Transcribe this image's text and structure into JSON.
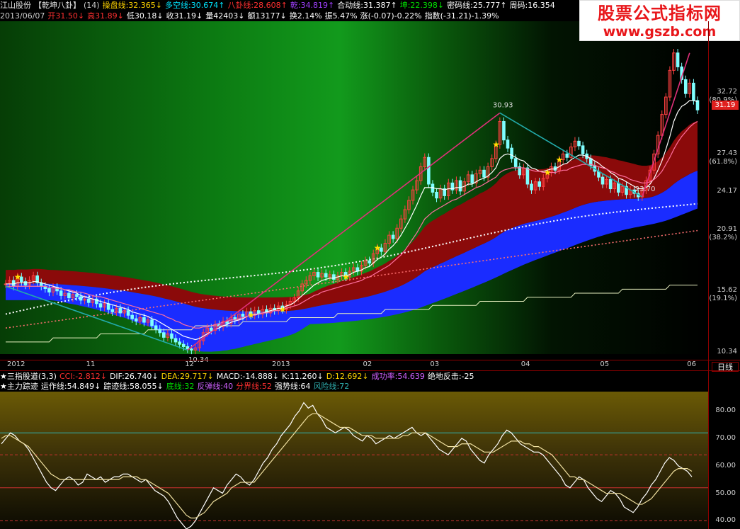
{
  "header": {
    "row1": [
      {
        "text": "江山股份",
        "color": "#e6e6e6"
      },
      {
        "text": "【乾坤八卦】",
        "color": "#e6e6e6"
      },
      {
        "text": "(14)",
        "color": "#cccccc"
      },
      {
        "text": "操盘线:32.365↓",
        "color": "#ffd400"
      },
      {
        "text": "多空线:30.674↑",
        "color": "#00e5ff"
      },
      {
        "text": "八卦线:28.608↑",
        "color": "#ff3030"
      },
      {
        "text": "乾:34.819↑",
        "color": "#a040ff"
      },
      {
        "text": "合动线:31.387↑",
        "color": "#ffffff"
      },
      {
        "text": "坤:22.398↓",
        "color": "#00e000"
      },
      {
        "text": "密码线:25.777↑",
        "color": "#ffffff"
      },
      {
        "text": "周码:16.354",
        "color": "#ffffff"
      }
    ],
    "row2": [
      {
        "text": "2013/06/07",
        "color": "#cccccc"
      },
      {
        "text": "开31.50↓",
        "color": "#ff3030"
      },
      {
        "text": "高31.89↓",
        "color": "#ff3030"
      },
      {
        "text": "低30.18↓",
        "color": "#ffffff"
      },
      {
        "text": "收31.19↓",
        "color": "#ffffff"
      },
      {
        "text": "量42403↓",
        "color": "#ffffff"
      },
      {
        "text": "额13177↓",
        "color": "#ffffff"
      },
      {
        "text": "换2.14%",
        "color": "#ffffff"
      },
      {
        "text": "振5.47%",
        "color": "#ffffff"
      },
      {
        "text": "涨(-0.07)-0.22%",
        "color": "#ffffff"
      },
      {
        "text": "指数(-31.21)-1.39%",
        "color": "#ffffff"
      }
    ]
  },
  "logo": {
    "line1": "股票公式指标网",
    "line2": "www.gszb.com"
  },
  "chart_data": [
    {
      "type": "line",
      "title": "",
      "ylim": [
        10.34,
        37.0
      ],
      "y_ticks": [
        {
          "v": 32.72,
          "pct": "(80.9%)"
        },
        {
          "v": 27.43,
          "pct": "(61.8%)"
        },
        {
          "v": 24.17,
          "pct": ""
        },
        {
          "v": 20.91,
          "pct": "(38.2%)"
        },
        {
          "v": 15.62,
          "pct": "(19.1%)"
        },
        {
          "v": 10.34,
          "pct": ""
        }
      ],
      "x_ticks": [
        {
          "label": "2012",
          "i": 0
        },
        {
          "label": "11",
          "i": 20
        },
        {
          "label": "12",
          "i": 45
        },
        {
          "label": "2013",
          "i": 67
        },
        {
          "label": "02",
          "i": 90
        },
        {
          "label": "03",
          "i": 107
        },
        {
          "label": "04",
          "i": 130
        },
        {
          "label": "05",
          "i": 150
        },
        {
          "label": "06",
          "i": 172
        }
      ],
      "current_price": "31.19",
      "annotations": [
        {
          "text": "30.93",
          "i": 125,
          "v": 30.93
        },
        {
          "text": "23.70",
          "i": 161,
          "v": 23.7
        },
        {
          "text": "10.34",
          "i": 48,
          "v": 10.34
        }
      ],
      "close": [
        16.2,
        16.5,
        16.0,
        16.8,
        16.4,
        16.1,
        16.5,
        16.9,
        16.3,
        16.0,
        15.8,
        15.5,
        15.9,
        15.6,
        15.2,
        15.4,
        15.0,
        15.3,
        15.1,
        14.8,
        14.9,
        14.6,
        14.9,
        14.5,
        14.2,
        14.5,
        14.0,
        13.8,
        14.1,
        13.7,
        13.9,
        13.5,
        13.2,
        13.0,
        13.3,
        12.9,
        13.1,
        12.6,
        12.3,
        12.0,
        11.6,
        11.9,
        11.5,
        11.2,
        11.0,
        10.8,
        10.6,
        10.5,
        10.7,
        11.3,
        12.0,
        12.4,
        12.2,
        12.7,
        12.5,
        13.0,
        12.8,
        13.3,
        13.1,
        13.6,
        13.4,
        13.8,
        13.5,
        13.9,
        13.6,
        14.0,
        13.7,
        14.1,
        13.9,
        14.3,
        14.0,
        14.4,
        14.7,
        15.0,
        15.6,
        16.2,
        16.5,
        16.9,
        17.2,
        16.8,
        17.1,
        16.8,
        17.0,
        16.6,
        16.9,
        17.2,
        16.8,
        17.3,
        17.6,
        17.3,
        17.8,
        18.2,
        18.0,
        18.8,
        19.3,
        19.0,
        19.7,
        20.4,
        20.1,
        21.0,
        21.8,
        22.6,
        23.4,
        24.3,
        25.1,
        26.3,
        27.1,
        24.8,
        24.1,
        23.6,
        24.4,
        23.8,
        24.9,
        24.3,
        25.1,
        24.2,
        25.0,
        25.6,
        24.9,
        25.7,
        26.0,
        25.4,
        26.3,
        27.0,
        28.2,
        30.2,
        28.6,
        27.9,
        27.0,
        26.3,
        25.6,
        26.2,
        24.8,
        24.3,
        25.0,
        24.6,
        25.3,
        25.8,
        26.3,
        26.0,
        26.9,
        27.4,
        27.1,
        28.0,
        28.5,
        28.1,
        27.4,
        27.0,
        26.4,
        25.9,
        25.4,
        24.8,
        25.2,
        24.4,
        24.9,
        24.1,
        24.6,
        23.9,
        24.3,
        24.0,
        23.7,
        24.3,
        25.1,
        26.0,
        27.4,
        29.0,
        30.8,
        32.3,
        34.6,
        36.1,
        34.9,
        33.8,
        32.6,
        33.5,
        32.0,
        31.19
      ],
      "series": [
        {
          "name": "",
          "color": "#ffffff",
          "values": [
            16.2,
            16.2,
            16.2,
            16.3,
            16.3,
            16.3,
            16.3,
            16.4,
            16.4,
            16.3,
            16.2,
            16.1,
            16.0,
            15.9,
            15.8,
            15.7,
            15.6,
            15.5,
            15.4,
            15.2,
            15.1,
            15.0,
            14.9,
            14.8,
            14.7,
            14.6,
            14.5,
            14.4,
            14.3,
            14.2,
            14.1,
            14.0,
            13.8,
            13.7,
            13.6,
            13.5,
            13.4,
            13.2,
            13.1,
            12.9,
            12.7,
            12.5,
            12.3,
            12.1,
            11.9,
            11.7,
            11.6,
            11.5,
            11.4,
            11.5,
            11.7,
            11.9,
            12.1,
            12.3,
            12.4,
            12.6,
            12.7,
            12.9,
            13.0,
            13.1,
            13.2,
            13.4,
            13.5,
            13.6,
            13.6,
            13.7,
            13.8,
            13.9,
            14.0,
            14.1,
            14.1,
            14.3,
            14.4,
            14.6,
            14.9,
            15.2,
            15.5,
            15.8,
            16.1,
            16.3,
            16.5,
            16.6,
            16.7,
            16.7,
            16.8,
            16.9,
            16.9,
            17.0,
            17.2,
            17.3,
            17.4,
            17.6,
            17.7,
            18.0,
            18.3,
            18.5,
            18.8,
            19.2,
            19.5,
            19.9,
            20.4,
            21.0,
            21.6,
            22.3,
            23.0,
            23.8,
            24.5,
            24.5,
            24.5,
            24.4,
            24.4,
            24.3,
            24.4,
            24.4,
            24.5,
            24.5,
            24.6,
            24.8,
            24.8,
            25.0,
            25.2,
            25.3,
            25.5,
            25.8,
            26.2,
            27.0,
            27.3,
            27.4,
            27.3,
            27.1,
            26.9,
            26.8,
            26.5,
            26.2,
            26.1,
            25.9,
            25.9,
            26.0,
            26.1,
            26.1,
            26.3,
            26.5,
            26.6,
            26.9,
            27.1,
            27.3,
            27.3,
            27.2,
            27.0,
            26.8,
            26.6,
            26.3,
            26.1,
            25.8,
            25.6,
            25.3,
            25.2,
            25.0,
            24.8,
            24.6,
            24.4,
            24.4,
            24.5,
            24.8,
            25.3,
            26.0,
            26.8,
            27.8,
            28.9,
            30.2,
            31.0,
            31.5,
            31.7,
            32.0,
            32.0,
            31.9
          ]
        },
        {
          "name": "",
          "color": "#ff6fa0",
          "values": [
            16.0,
            16.0,
            16.0,
            16.0,
            16.0,
            16.0,
            16.0,
            16.0,
            16.0,
            16.0,
            16.0,
            15.9,
            15.9,
            15.8,
            15.8,
            15.7,
            15.7,
            15.6,
            15.5,
            15.5,
            15.4,
            15.3,
            15.2,
            15.1,
            15.1,
            15.0,
            14.9,
            14.8,
            14.7,
            14.6,
            14.5,
            14.4,
            14.3,
            14.2,
            14.1,
            14.0,
            13.9,
            13.8,
            13.7,
            13.6,
            13.5,
            13.3,
            13.2,
            13.0,
            12.9,
            12.7,
            12.6,
            12.5,
            12.4,
            12.4,
            12.5,
            12.5,
            12.6,
            12.7,
            12.8,
            12.9,
            13.0,
            13.1,
            13.1,
            13.2,
            13.3,
            13.4,
            13.5,
            13.5,
            13.6,
            13.7,
            13.7,
            13.8,
            13.9,
            13.9,
            14.0,
            14.1,
            14.2,
            14.3,
            14.4,
            14.6,
            14.8,
            15.0,
            15.2,
            15.3,
            15.5,
            15.6,
            15.7,
            15.8,
            15.9,
            16.0,
            16.1,
            16.2,
            16.3,
            16.4,
            16.5,
            16.7,
            16.8,
            17.0,
            17.2,
            17.4,
            17.6,
            17.8,
            18.1,
            18.4,
            18.7,
            19.1,
            19.6,
            20.1,
            20.6,
            21.2,
            21.8,
            22.1,
            22.4,
            22.6,
            22.8,
            23.0,
            23.2,
            23.4,
            23.5,
            23.7,
            23.9,
            24.1,
            24.3,
            24.5,
            24.6,
            24.8,
            25.0,
            25.2,
            25.4,
            25.8,
            26.0,
            26.1,
            26.2,
            26.2,
            26.2,
            26.2,
            26.1,
            26.0,
            25.9,
            25.9,
            25.8,
            25.8,
            25.8,
            25.8,
            25.9,
            26.0,
            26.0,
            26.2,
            26.3,
            26.4,
            26.5,
            26.5,
            26.5,
            26.4,
            26.3,
            26.2,
            26.1,
            25.9,
            25.8,
            25.6,
            25.5,
            25.4,
            25.2,
            25.1,
            25.0,
            24.9,
            24.9,
            25.0,
            25.2,
            25.5,
            25.9,
            26.5,
            27.1,
            27.8,
            28.4,
            28.9,
            29.3,
            29.7,
            30.0,
            30.2
          ]
        }
      ]
    },
    {
      "type": "line",
      "ylim": [
        37,
        87
      ],
      "y_ticks": [
        80.0,
        70.0,
        60.0,
        50.0,
        40.0
      ],
      "ref_lines": [
        {
          "v": 72,
          "color": "#2fb0b0"
        },
        {
          "v": 64,
          "color": "#cc3030",
          "dash": true
        },
        {
          "v": 52,
          "color": "#cc3030"
        },
        {
          "v": 40,
          "color": "#cc3030",
          "dash": true
        }
      ],
      "series": [
        {
          "name": "运作线",
          "color": "#ffffff",
          "values": [
            68,
            70,
            72,
            71,
            69,
            68,
            66,
            63,
            60,
            57,
            54,
            52,
            51,
            53,
            55,
            56,
            55,
            53,
            54,
            57,
            56,
            55,
            56,
            54,
            55,
            56,
            56,
            57,
            57,
            56,
            55,
            54,
            55,
            53,
            51,
            50,
            49,
            47,
            44,
            41,
            39,
            37,
            38,
            40,
            43,
            46,
            49,
            52,
            51,
            50,
            53,
            55,
            57,
            56,
            54,
            53,
            55,
            58,
            61,
            63,
            66,
            68,
            71,
            73,
            75,
            78,
            80,
            83,
            81,
            82,
            79,
            77,
            74,
            73,
            72,
            73,
            74,
            73,
            71,
            70,
            69,
            71,
            70,
            68,
            69,
            70,
            71,
            70,
            71,
            72,
            73,
            74,
            72,
            71,
            72,
            70,
            68,
            66,
            65,
            64,
            66,
            68,
            70,
            69,
            66,
            64,
            62,
            61,
            64,
            66,
            68,
            71,
            73,
            72,
            70,
            68,
            67,
            66,
            65,
            65,
            64,
            62,
            60,
            58,
            56,
            53,
            52,
            54,
            56,
            55,
            52,
            50,
            48,
            47,
            49,
            51,
            50,
            48,
            45,
            44,
            43,
            45,
            48,
            50,
            53,
            55,
            58,
            61,
            63,
            62,
            60,
            59,
            58,
            56
          ]
        },
        {
          "name": "踪迹线",
          "color": "#f0e0a0",
          "values": [
            70,
            71,
            71,
            70,
            69,
            68,
            67,
            65,
            63,
            61,
            59,
            57,
            56,
            55,
            55,
            55,
            55,
            55,
            55,
            55,
            55,
            55,
            55,
            55,
            55,
            55,
            55,
            56,
            56,
            56,
            56,
            55,
            55,
            54,
            53,
            52,
            51,
            50,
            48,
            46,
            44,
            42,
            41,
            41,
            42,
            43,
            45,
            47,
            48,
            49,
            50,
            52,
            53,
            54,
            54,
            54,
            54,
            56,
            58,
            60,
            62,
            64,
            66,
            68,
            70,
            72,
            74,
            76,
            78,
            79,
            79,
            78,
            77,
            76,
            75,
            74,
            74,
            74,
            73,
            72,
            71,
            71,
            71,
            70,
            70,
            70,
            70,
            70,
            70,
            71,
            71,
            72,
            72,
            72,
            72,
            71,
            70,
            69,
            68,
            67,
            67,
            67,
            68,
            68,
            68,
            67,
            66,
            65,
            65,
            65,
            66,
            67,
            68,
            69,
            69,
            69,
            68,
            68,
            67,
            67,
            66,
            65,
            64,
            62,
            60,
            58,
            56,
            56,
            55,
            55,
            54,
            53,
            52,
            51,
            50,
            50,
            50,
            50,
            49,
            48,
            47,
            46,
            46,
            47,
            48,
            50,
            52,
            54,
            56,
            58,
            59,
            59,
            59,
            58
          ]
        }
      ],
      "ind_label": "主力踪迹"
    }
  ],
  "indicator1": [
    {
      "text": "★三指股道(3,3)",
      "color": "#ffffff"
    },
    {
      "text": "CCI:-2.812↓",
      "color": "#ff3030"
    },
    {
      "text": "DIF:26.740↓",
      "color": "#ffffff"
    },
    {
      "text": "DEA:29.717↓",
      "color": "#ffd400"
    },
    {
      "text": "MACD:-14.888↓",
      "color": "#ffffff"
    },
    {
      "text": "K:11.260↓",
      "color": "#ffffff"
    },
    {
      "text": "D:12.692↓",
      "color": "#ffd400"
    },
    {
      "text": "成功率:54.639",
      "color": "#d060ff"
    },
    {
      "text": "绝地反击:-25",
      "color": "#ffffff"
    }
  ],
  "indicator2": [
    {
      "text": "★主力踪迹",
      "color": "#ffffff"
    },
    {
      "text": "运作线:54.849↓",
      "color": "#ffffff"
    },
    {
      "text": "踪迹线:58.055↓",
      "color": "#ffffff"
    },
    {
      "text": "底线:32",
      "color": "#00e000"
    },
    {
      "text": "反弹线:40",
      "color": "#d060ff"
    },
    {
      "text": "分界线:52",
      "color": "#ff3030"
    },
    {
      "text": "强势线:64",
      "color": "#ffffff"
    },
    {
      "text": "风险线:72",
      "color": "#2fb0b0"
    }
  ],
  "day_button": "日线"
}
